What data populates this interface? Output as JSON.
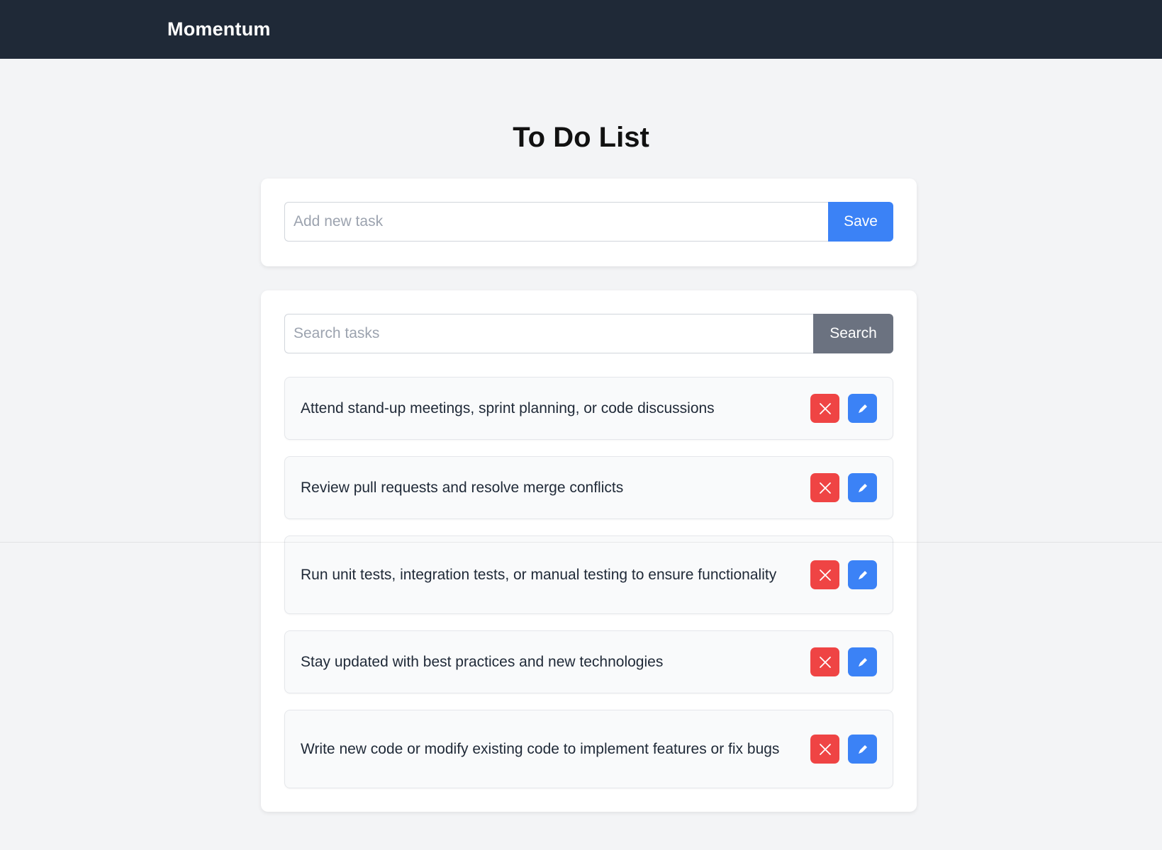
{
  "app": {
    "brand": "Momentum"
  },
  "page": {
    "title": "To Do List"
  },
  "add_task": {
    "placeholder": "Add new task",
    "value": "",
    "save_label": "Save"
  },
  "search": {
    "placeholder": "Search tasks",
    "value": "",
    "button_label": "Search"
  },
  "tasks": [
    {
      "text": "Attend stand-up meetings, sprint planning, or code discussions"
    },
    {
      "text": "Review pull requests and resolve merge conflicts"
    },
    {
      "text": "Run unit tests, integration tests, or manual testing to ensure functionality"
    },
    {
      "text": "Stay updated with best practices and new technologies"
    },
    {
      "text": "Write new code or modify existing code to implement features or fix bugs"
    }
  ],
  "icons": {
    "delete": "close-icon",
    "edit": "pencil-icon"
  },
  "colors": {
    "navbar": "#1f2937",
    "primary": "#3b82f6",
    "danger": "#ef4444",
    "secondary": "#6b7280",
    "background": "#f3f4f6"
  }
}
